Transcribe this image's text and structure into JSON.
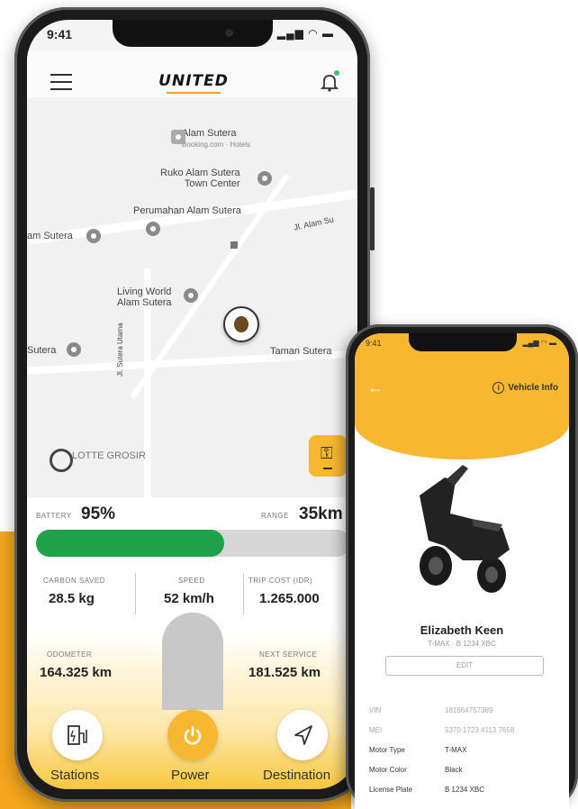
{
  "main_app": {
    "status_time": "9:41",
    "brand": "UNITED",
    "map": {
      "places": [
        {
          "name": "Alam Sutera",
          "sub": "Booking.com · Hotels"
        },
        {
          "name": "Ruko Alam Sutera\nTown Center"
        },
        {
          "name": "Perumahan Alam Sutera"
        },
        {
          "name": "am Sutera"
        },
        {
          "name": "Jl. Alam Su"
        },
        {
          "name": "Living World\nAlam Sutera"
        },
        {
          "name": "Sutera"
        },
        {
          "name": "Taman Sutera"
        },
        {
          "name": "Jl. Sutera Utama"
        },
        {
          "name": "LOTTE GROSIR"
        }
      ]
    },
    "battery_label": "BATTERY",
    "battery_value": "95%",
    "battery_level": 0.6,
    "range_label": "RANGE",
    "range_value": "35km",
    "stats": [
      {
        "label": "CARBON SAVED",
        "value": "28.5 kg"
      },
      {
        "label": "SPEED",
        "value": "52 km/h"
      },
      {
        "label": "TRIP COST (IDR)",
        "value": "1.265.000"
      },
      {
        "label": "ODOMETER",
        "value": "164.325 km"
      },
      {
        "label": "NEXT SERVICE",
        "value": "181.525 km"
      }
    ],
    "nav": {
      "stations": "Stations",
      "power": "Power",
      "destination": "Destination"
    }
  },
  "vehicle_app": {
    "header_title": "Vehicle Info",
    "owner_name": "Elizabeth Keen",
    "owner_sub": "T-MAX · B 1234 XBC",
    "edit_label": "EDIT",
    "rows": [
      {
        "key": "VIN",
        "value": "181664757389"
      },
      {
        "key": "MEI",
        "value": "5370 1723 4113 7658"
      },
      {
        "key": "Motor Type",
        "value": "T-MAX"
      },
      {
        "key": "Motor Color",
        "value": "Black"
      },
      {
        "key": "License Plate",
        "value": "B 1234 XBC"
      }
    ]
  },
  "colors": {
    "accent": "#f7b731",
    "background_orange": "#f2a51d",
    "battery_green": "#1fa24a"
  }
}
